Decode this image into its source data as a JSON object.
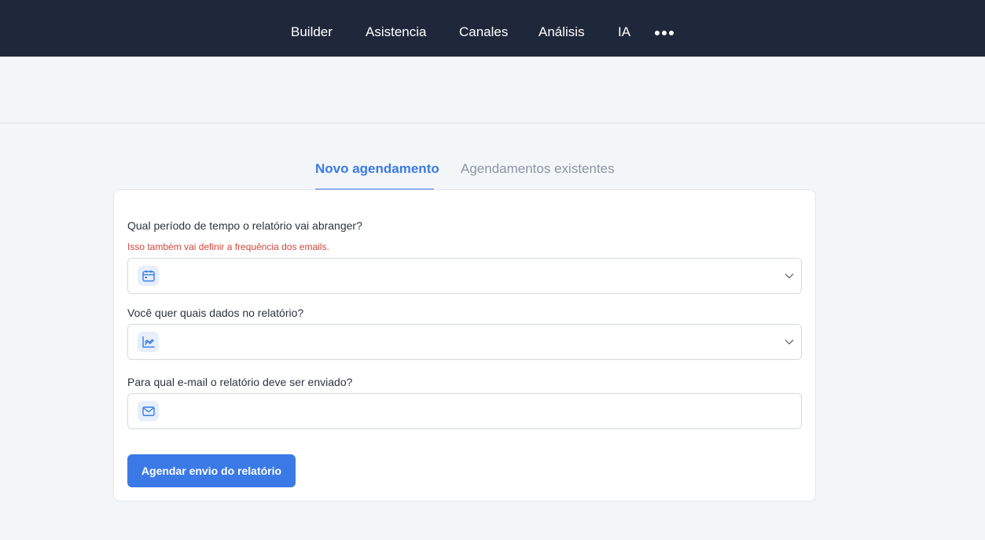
{
  "nav": {
    "items": [
      {
        "label": "Builder"
      },
      {
        "label": "Asistencia"
      },
      {
        "label": "Canales"
      },
      {
        "label": "Análisis"
      },
      {
        "label": "IA"
      }
    ],
    "more_icon": "more-dots-icon"
  },
  "tabs": [
    {
      "label": "Novo agendamento",
      "active": true
    },
    {
      "label": "Agendamentos existentes",
      "active": false
    }
  ],
  "form": {
    "period": {
      "label": "Qual período de tempo o relatório vai abranger?",
      "hint": "Isso também vai definir a frequência dos emails.",
      "icon": "calendar-icon",
      "value": ""
    },
    "data": {
      "label": "Você quer quais dados no relatório?",
      "icon": "line-chart-icon",
      "value": ""
    },
    "email": {
      "label": "Para qual e-mail o relatório deve ser enviado?",
      "icon": "mail-icon",
      "value": ""
    },
    "submit_label": "Agendar envio do relatório"
  },
  "colors": {
    "nav_bg": "#1f283b",
    "accent": "#3b7ae6",
    "hint": "#d0463d",
    "page_bg": "#f3f6f8"
  }
}
